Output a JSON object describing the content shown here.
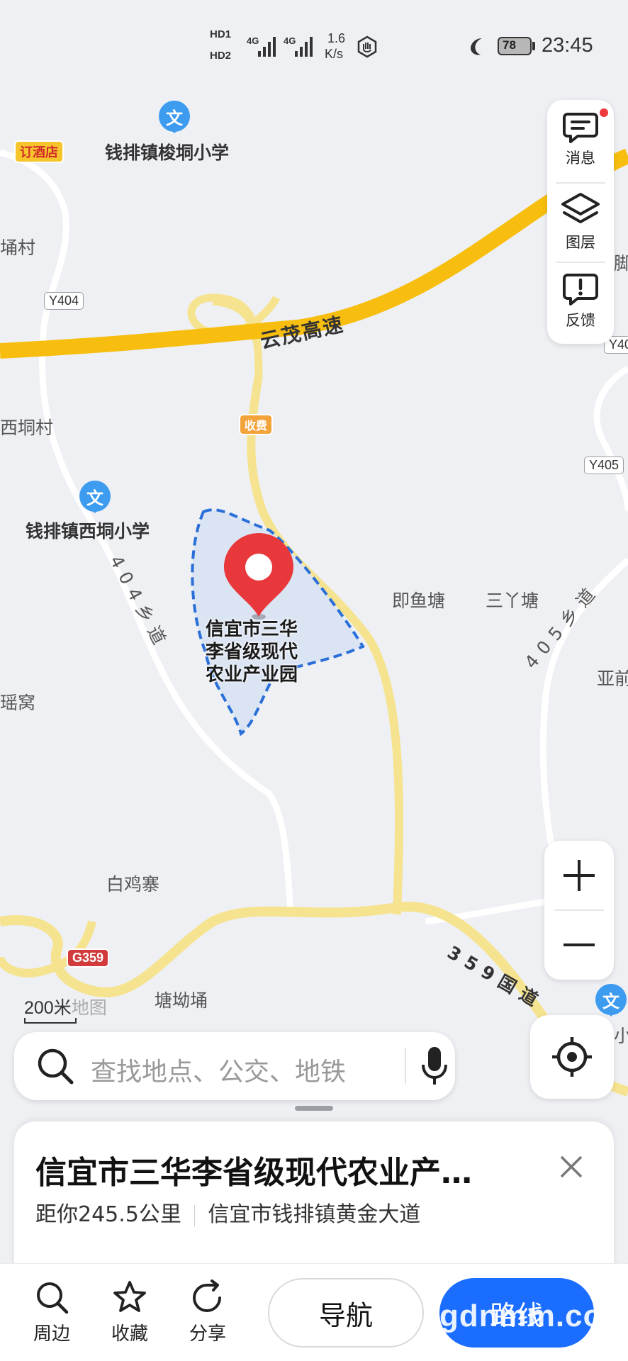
{
  "status_bar": {
    "hd1": "HD1",
    "hd2": "HD2",
    "net1": "4G",
    "net2": "4G",
    "speed_value": "1.6",
    "speed_unit": "K/s",
    "battery": "78",
    "time": "23:45"
  },
  "tools": {
    "messages_label": "消息",
    "layers_label": "图层",
    "feedback_label": "反馈"
  },
  "map": {
    "hotel_badge": "订酒店",
    "school_top": "钱排镇梭垌小学",
    "school_left": "钱排镇西垌小学",
    "school_icon_char": "文",
    "highway": "云茂高速",
    "toll": "收费",
    "village_tl": "埇村",
    "village_xd": "西垌村",
    "village_yw": "瑶窝",
    "badge_y404": "Y404",
    "badge_y405": "Y405",
    "badge_y40_right": "Y40",
    "badge_g359": "G359",
    "road_404": "404乡道",
    "road_405": "405乡道",
    "road_359": "359国道",
    "jiyutang": "即鱼塘",
    "sanyatang": "三丫塘",
    "ya": "亚前",
    "baijizhai": "白鸡寨",
    "tangaoyong": "塘坳埇",
    "edge_jiao": "脚",
    "edge_xiao": "小",
    "park_label_line1": "信宜市三华",
    "park_label_line2": "李省级现代",
    "park_label_line3": "农业产业园",
    "scale": "200米",
    "scale_suffix": "地图"
  },
  "search": {
    "placeholder": "查找地点、公交、地铁"
  },
  "place": {
    "title": "信宜市三华李省级现代农业产…",
    "distance": "距你245.5公里",
    "address": "信宜市钱排镇黄金大道"
  },
  "actions": {
    "nearby": "周边",
    "favorite": "收藏",
    "share": "分享",
    "navigate": "导航",
    "route": "路线"
  },
  "watermark": "gdnmm.com",
  "colors": {
    "highway": "#f7be0f",
    "local_road": "#f6e7a1",
    "primary_blue": "#1a6dff",
    "pin_red": "#e8383b",
    "area_fill": "#dbe4f3",
    "area_border": "#2a6fd8"
  }
}
